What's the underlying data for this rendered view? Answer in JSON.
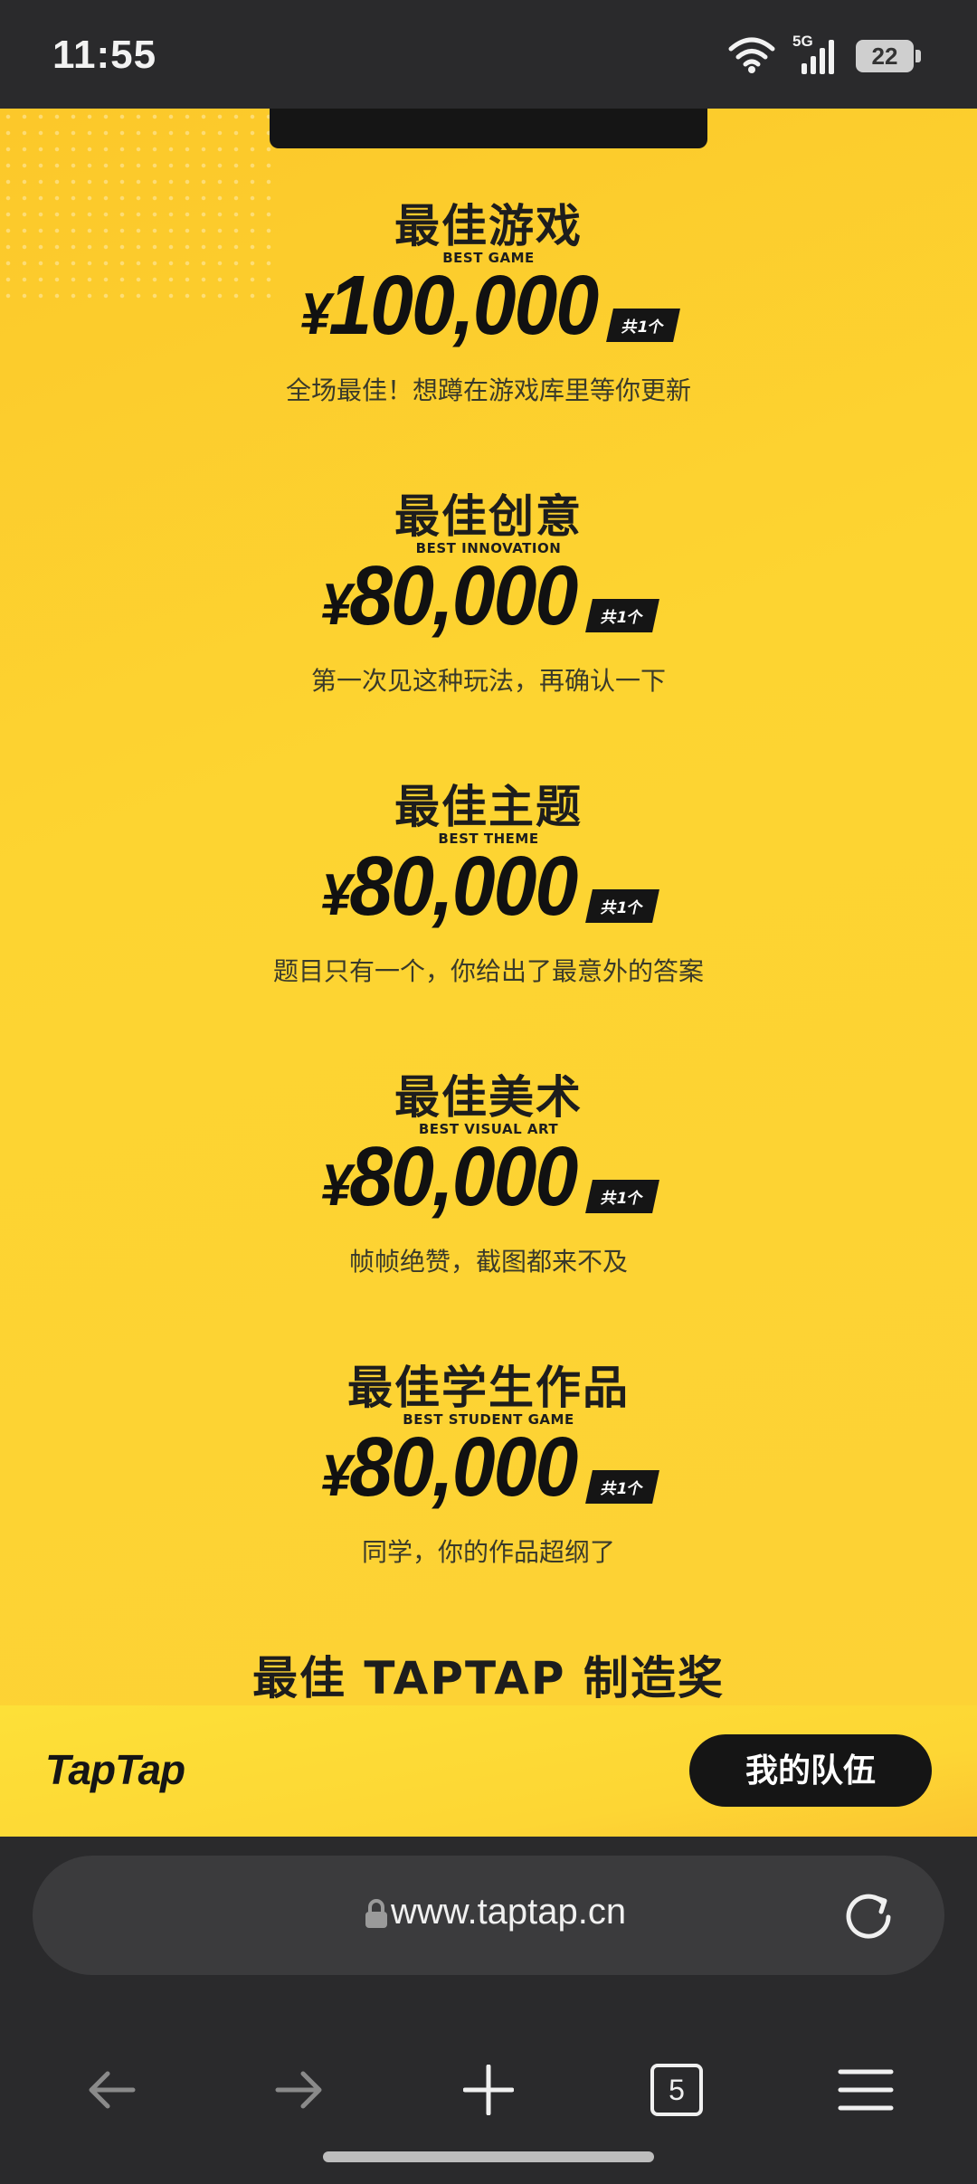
{
  "status_bar": {
    "time": "11:55",
    "network": "5G",
    "battery": "22",
    "icons": [
      "wifi-icon",
      "signal-icon",
      "battery-icon"
    ]
  },
  "awards": [
    {
      "title": "最佳游戏",
      "title_en": "BEST GAME",
      "currency": "¥",
      "amount": "100,000",
      "count": "共1个",
      "desc": "全场最佳！想蹲在游戏库里等你更新"
    },
    {
      "title": "最佳创意",
      "title_en": "BEST INNOVATION",
      "currency": "¥",
      "amount": "80,000",
      "count": "共1个",
      "desc": "第一次见这种玩法，再确认一下"
    },
    {
      "title": "最佳主题",
      "title_en": "BEST THEME",
      "currency": "¥",
      "amount": "80,000",
      "count": "共1个",
      "desc": "题目只有一个，你给出了最意外的答案"
    },
    {
      "title": "最佳美术",
      "title_en": "BEST VISUAL ART",
      "currency": "¥",
      "amount": "80,000",
      "count": "共1个",
      "desc": "帧帧绝赞，截图都来不及"
    },
    {
      "title": "最佳学生作品",
      "title_en": "BEST STUDENT GAME",
      "currency": "¥",
      "amount": "80,000",
      "count": "共1个",
      "desc": "同学，你的作品超纲了"
    },
    {
      "title": "最佳 TAPTAP 制造奖"
    }
  ],
  "footer": {
    "logo": "TapTap",
    "my_team_button": "我的队伍"
  },
  "browser": {
    "url": "www.taptap.cn",
    "tab_count": "5",
    "icons": [
      "lock-icon",
      "reload-icon",
      "back-arrow-icon",
      "forward-arrow-icon",
      "new-tab-plus-icon",
      "tabs-icon",
      "menu-icon"
    ]
  },
  "colors": {
    "page_yellow": "#fdd232",
    "dark": "#151515",
    "chrome": "#2a2a2c"
  }
}
